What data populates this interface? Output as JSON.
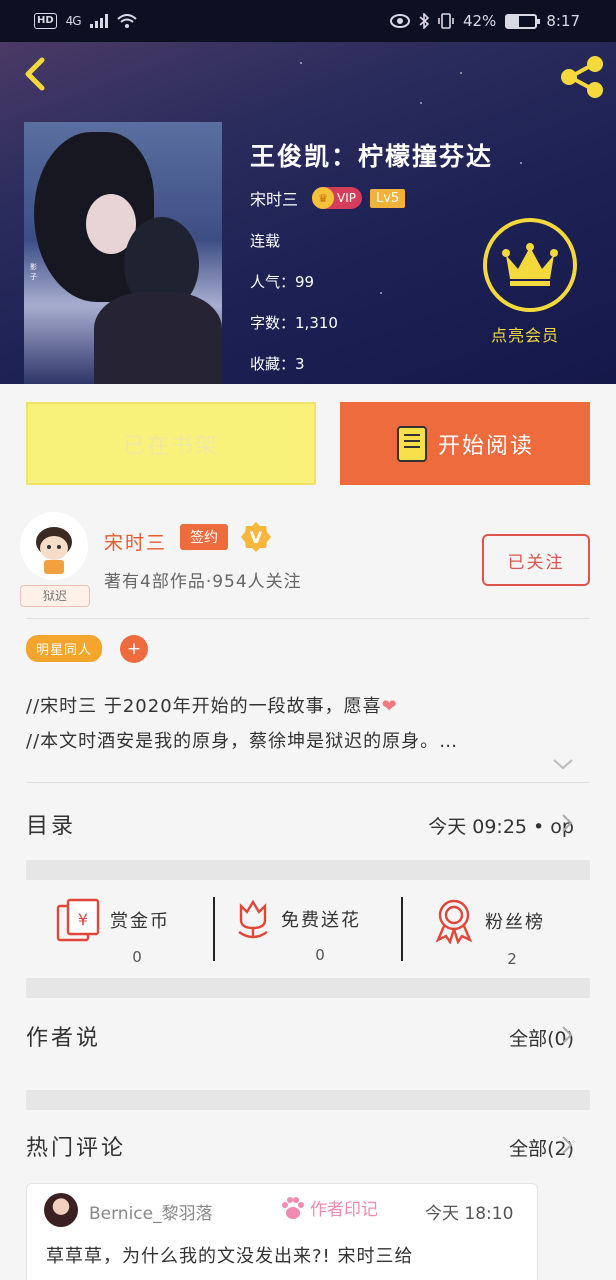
{
  "status_bar": {
    "hd": "HD",
    "network": "4G",
    "battery": "42%",
    "battery_level": 0.42,
    "time": "8:17"
  },
  "book": {
    "title": "王俊凯：柠檬撞芬达",
    "author": "宋时三",
    "vip": "VIP",
    "level": "Lv5",
    "status": "连载",
    "popularity_label": "人气：",
    "popularity": "99",
    "words_label": "字数：",
    "words": "1,310",
    "favorites_label": "收藏：",
    "favorites": "3"
  },
  "member": {
    "label": "点亮会员"
  },
  "actions": {
    "shelf": "已在书架",
    "read": "开始阅读"
  },
  "author": {
    "name": "宋时三",
    "signed": "签约",
    "verified": "V",
    "avatar_tag": "狱迟",
    "summary": "著有4部作品·954人关注",
    "follow": "已关注"
  },
  "tags": [
    "明星同人"
  ],
  "tag_add": "+",
  "intro": {
    "line1": "//宋时三 于2020年开始的一段故事，愿喜",
    "heart": "❤",
    "line2": "//本文时酒安是我的原身，蔡徐坤是狱迟的原身。…"
  },
  "toc": {
    "title": "目录",
    "update": "今天 09:25 • op"
  },
  "stats": [
    {
      "label": "赏金币",
      "value": "0",
      "icon": "red-envelope-yen-icon"
    },
    {
      "label": "免费送花",
      "value": "0",
      "icon": "flower-icon"
    },
    {
      "label": "粉丝榜",
      "value": "2",
      "icon": "award-ribbon-icon"
    }
  ],
  "author_notes": {
    "title": "作者说",
    "all": "全部(0)"
  },
  "hot_comments": {
    "title": "热门评论",
    "all": "全部(2)"
  },
  "comment": {
    "user": "Bernice_黎羽落",
    "badge": "作者印记",
    "time": "今天 18:10",
    "text": "草草草，为什么我的文没发出来?! 宋时三给"
  },
  "colors": {
    "accent": "#ee6b3e",
    "gold": "#f4d93d",
    "shelf": "#f8f27a",
    "hero": "#1d2154"
  }
}
